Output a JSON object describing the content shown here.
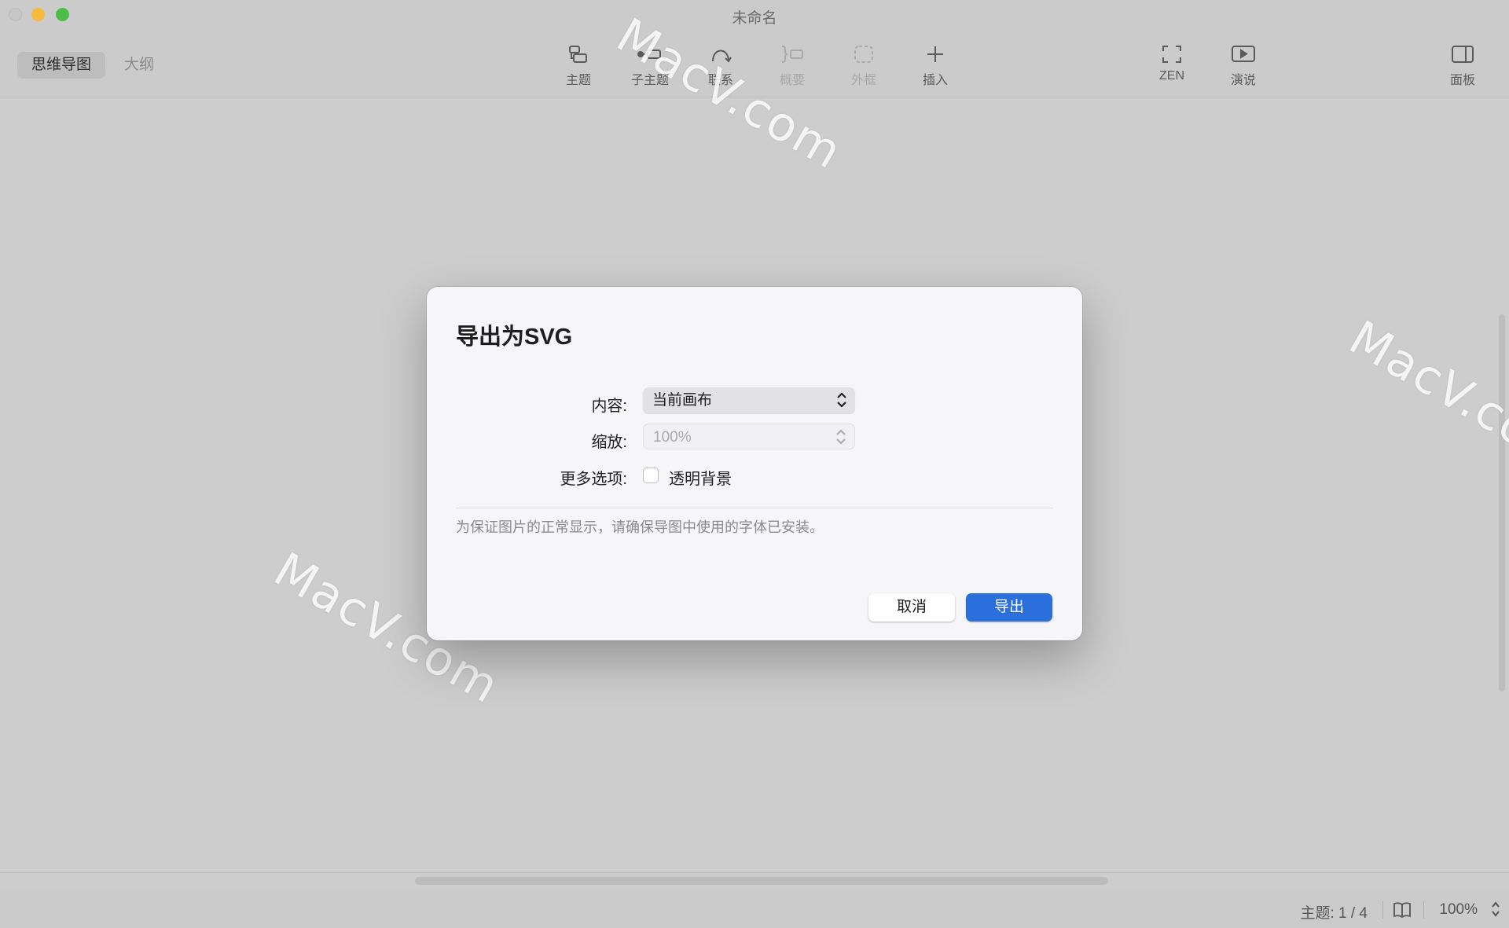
{
  "window": {
    "title": "未命名"
  },
  "view_switch": {
    "mindmap": "思维导图",
    "outline": "大纲"
  },
  "toolbar": {
    "topic": "主题",
    "subtopic": "子主题",
    "relation": "联系",
    "summary": "概要",
    "boundary": "外框",
    "insert": "插入",
    "zen": "ZEN",
    "present": "演说",
    "panel": "面板"
  },
  "dialog": {
    "title": "导出为SVG",
    "content_label": "内容:",
    "content_value": "当前画布",
    "scale_label": "缩放:",
    "scale_value": "100%",
    "more_label": "更多选项:",
    "transparent_label": "透明背景",
    "transparent_checked": false,
    "hint": "为保证图片的正常显示，请确保导图中使用的字体已安装。",
    "cancel": "取消",
    "export": "导出"
  },
  "status": {
    "topic_count": "主题: 1 / 4",
    "zoom": "100%"
  },
  "watermark": "MacV.com",
  "colors": {
    "accent": "#2a6fdb",
    "background": "#cdcdcd"
  }
}
